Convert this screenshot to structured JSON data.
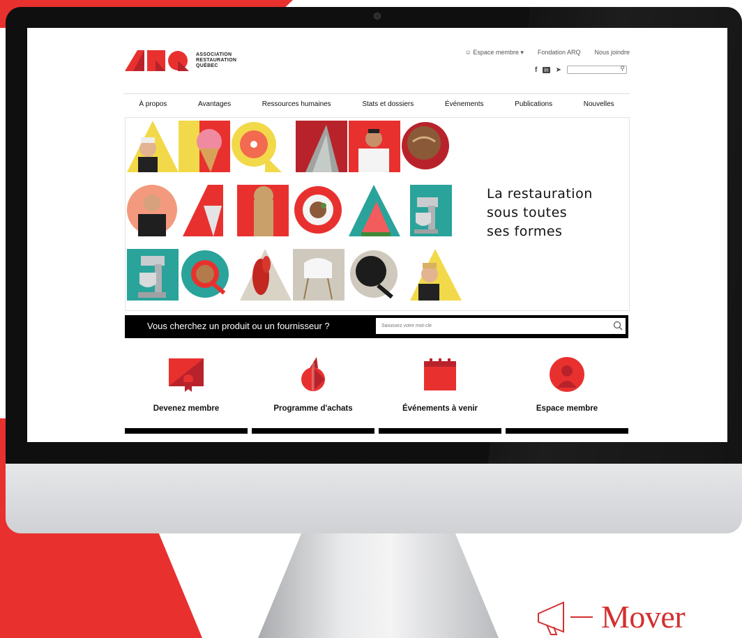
{
  "site": {
    "logo": {
      "letters": "ARQ",
      "line1": "ASSOCIATION",
      "line2": "RESTAURATION",
      "line3": "QUÉBEC"
    },
    "top_links": {
      "member_space": "Espace membre",
      "foundation": "Fondation ARQ",
      "contact": "Nous joindre"
    },
    "social": {
      "facebook": "f",
      "linkedin": "in"
    },
    "nav": [
      "À propos",
      "Avantages",
      "Ressources humaines",
      "Stats et dossiers",
      "Événements",
      "Publications",
      "Nouvelles"
    ],
    "hero": {
      "line1": "La restauration",
      "line2": "sous toutes",
      "line3": "ses formes"
    },
    "search": {
      "label": "Vous cherchez un produit ou un fournisseur ?",
      "placeholder": "Saisissez votre mot-clé"
    },
    "features": [
      {
        "label": "Devenez membre",
        "icon": "certificate-icon"
      },
      {
        "label": "Programme d'achats",
        "icon": "dollar-icon"
      },
      {
        "label": "Événements à venir",
        "icon": "calendar-icon"
      },
      {
        "label": "Espace membre",
        "icon": "member-icon"
      }
    ]
  },
  "brand": {
    "mover_text": "Mover",
    "accent": "#e8312f",
    "yellow": "#f2d94a",
    "teal": "#2aa39b",
    "grey": "#cfc9bd"
  }
}
